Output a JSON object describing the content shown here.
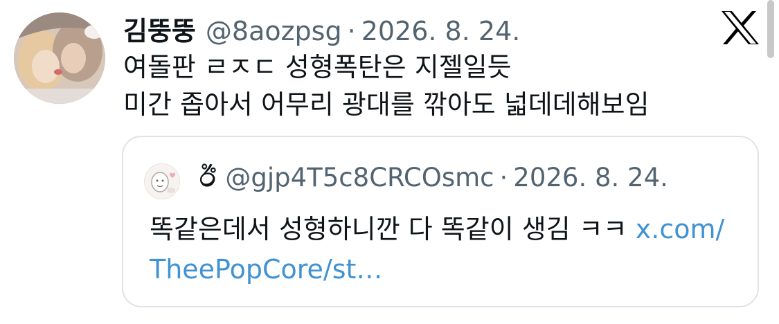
{
  "tweet": {
    "author_name": "김뚱뚱",
    "author_handle": "@8aozpsg",
    "separator": "·",
    "date": "2026. 8. 24.",
    "lines": [
      "여돌판 ㄹㅈㄷ 성형폭탄은 지젤일듯",
      "미간 좁아서 어무리 광대를 깎아도 넓데데해보임"
    ],
    "platform_icon": "x-logo-icon"
  },
  "quoted_tweet": {
    "author_name": "ඊ",
    "author_handle": "@gjp4T5c8CRCOsmc",
    "separator": "·",
    "date": "2026. 8. 24.",
    "text": "똑같은데서 성형하니깐 다 똑같이 생김 ㅋㅋ ",
    "link_part1": "x.com/",
    "link_part2": "TheePopCore/st…"
  },
  "colors": {
    "text_primary": "#0f1419",
    "text_secondary": "#536471",
    "link": "#4092d2",
    "border": "#dde3e8"
  }
}
